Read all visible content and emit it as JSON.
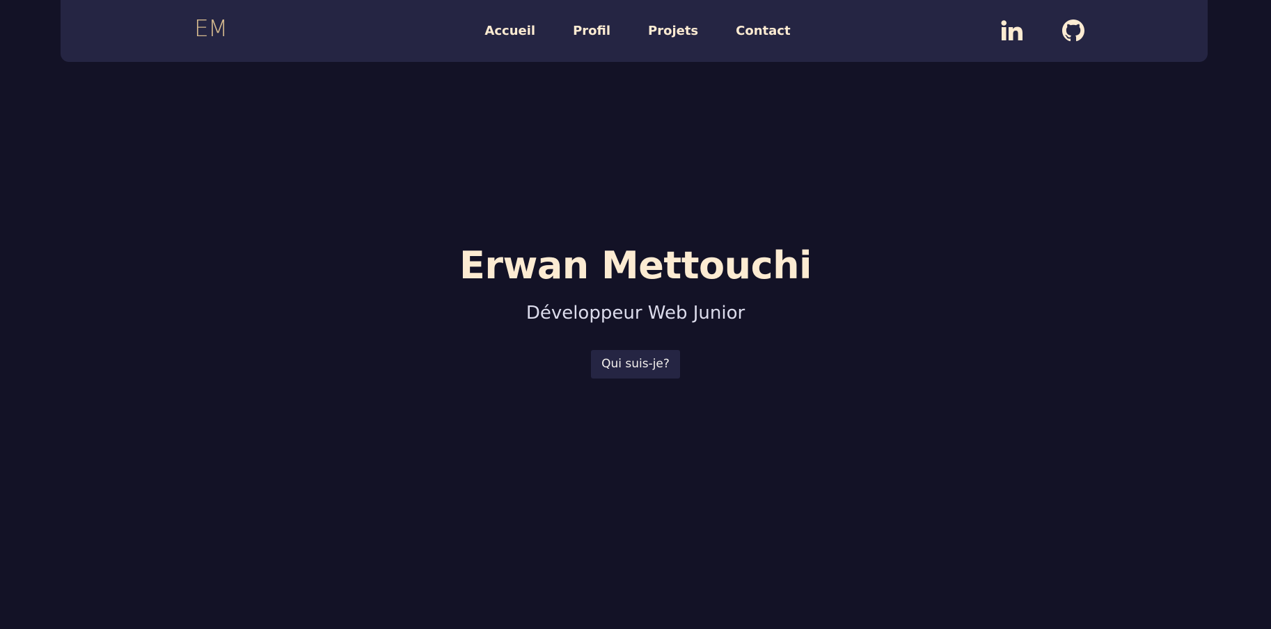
{
  "header": {
    "logo": "EM",
    "nav": [
      {
        "label": "Accueil"
      },
      {
        "label": "Profil"
      },
      {
        "label": "Projets"
      },
      {
        "label": "Contact"
      }
    ],
    "socials": [
      {
        "icon": "linkedin-icon"
      },
      {
        "icon": "github-icon"
      }
    ]
  },
  "hero": {
    "name": "Erwan Mettouchi",
    "role": "Développeur Web Junior",
    "button_label": "Qui suis-je?"
  },
  "colors": {
    "background": "#131226",
    "navbar": "#252543",
    "accent": "#fcebd2",
    "logo": "#d4b98e"
  }
}
